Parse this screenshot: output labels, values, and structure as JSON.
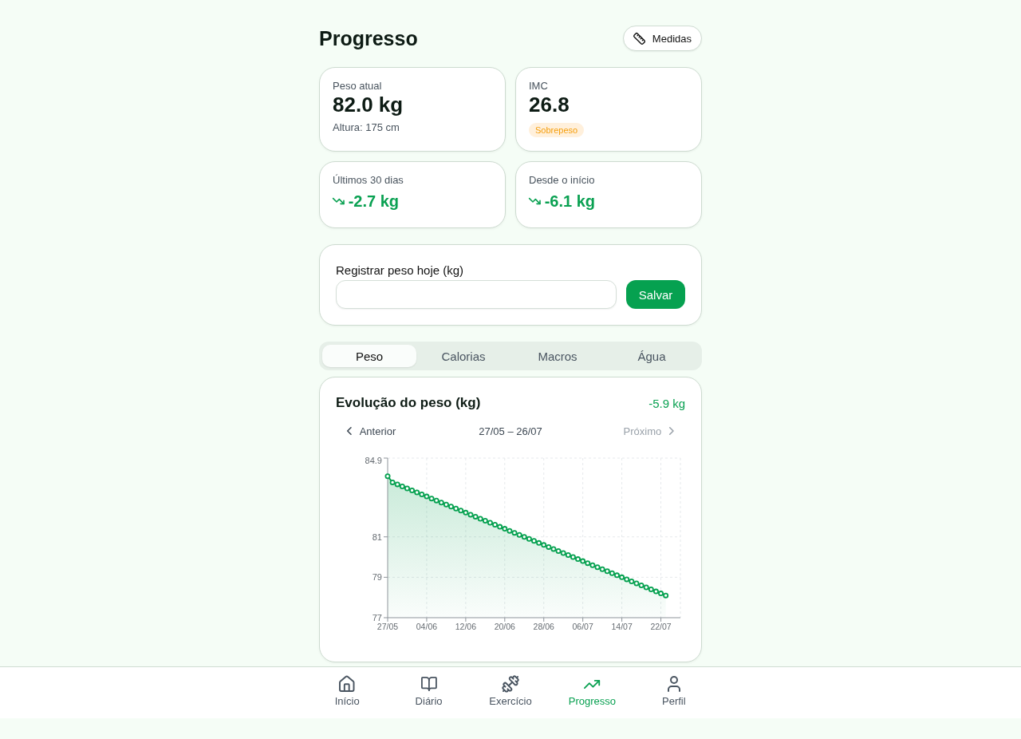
{
  "header": {
    "title": "Progresso",
    "button": "Medidas"
  },
  "stats": [
    {
      "kind": "value",
      "label": "Peso atual",
      "value": "82.0 kg",
      "note": "Altura: 175 cm"
    },
    {
      "kind": "value",
      "label": "IMC",
      "value": "26.8",
      "badge": "Sobrepeso"
    },
    {
      "kind": "change",
      "label": "Últimos 30 dias",
      "value": "-2.7 kg"
    },
    {
      "kind": "change",
      "label": "Desde o início",
      "value": "-6.1 kg"
    }
  ],
  "weight_form": {
    "label": "Registrar peso hoje (kg)",
    "button": "Salvar"
  },
  "tabs": [
    {
      "label": "Peso",
      "selected": true
    },
    {
      "label": "Calorias",
      "selected": false
    },
    {
      "label": "Macros",
      "selected": false
    },
    {
      "label": "Água",
      "selected": false
    }
  ],
  "chart_card": {
    "title": "Evolução do peso (kg)",
    "change": "-5.9 kg",
    "pager": {
      "previous": {
        "label": "Anterior",
        "disabled": false
      },
      "range": "27/05 – 26/07",
      "next": {
        "label": "Próximo",
        "disabled": true
      }
    },
    "chart_data": {
      "type": "area",
      "categories": [
        "27/05",
        null,
        null,
        null,
        null,
        null,
        null,
        null,
        "04/06",
        null,
        null,
        null,
        null,
        null,
        null,
        null,
        "12/06",
        null,
        null,
        null,
        null,
        null,
        null,
        null,
        "20/06",
        null,
        null,
        null,
        null,
        null,
        null,
        null,
        "28/06",
        null,
        null,
        null,
        null,
        null,
        null,
        null,
        "06/07",
        null,
        null,
        null,
        null,
        null,
        null,
        null,
        "14/07",
        null,
        null,
        null,
        null,
        null,
        null,
        null,
        "22/07",
        null
      ],
      "values": [
        84.0,
        83.7,
        83.6,
        83.5,
        83.4,
        83.3,
        83.2,
        83.1,
        83.0,
        82.9,
        82.8,
        82.7,
        82.6,
        82.5,
        82.4,
        82.3,
        82.2,
        82.1,
        82.0,
        81.9,
        81.8,
        81.7,
        81.6,
        81.5,
        81.4,
        81.3,
        81.2,
        81.1,
        81.0,
        80.9,
        80.8,
        80.7,
        80.6,
        80.5,
        80.4,
        80.3,
        80.2,
        80.1,
        80.0,
        79.9,
        79.8,
        79.7,
        79.6,
        79.5,
        79.4,
        79.3,
        79.2,
        79.1,
        79.0,
        78.9,
        78.8,
        78.7,
        78.6,
        78.5,
        78.4,
        78.3,
        78.2,
        78.1
      ],
      "ylim": [
        77,
        84.9
      ],
      "yticks": [
        77,
        79,
        81,
        84.9
      ],
      "grid": true
    }
  },
  "bottom_nav": [
    {
      "label": "Início",
      "selected": false
    },
    {
      "label": "Diário",
      "selected": false
    },
    {
      "label": "Exercício",
      "selected": false
    },
    {
      "label": "Progresso",
      "selected": true
    },
    {
      "label": "Perfil",
      "selected": false
    }
  ]
}
